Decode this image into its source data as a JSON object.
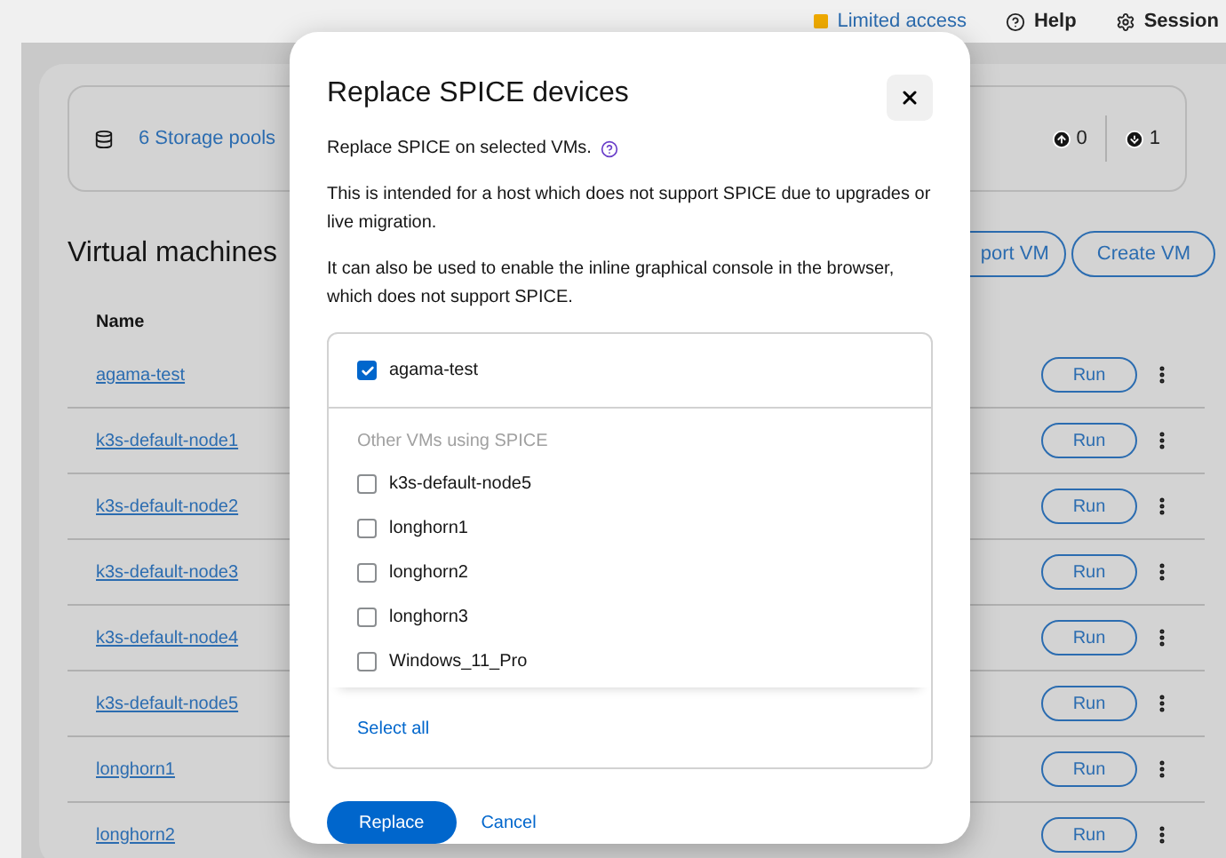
{
  "header": {
    "items": [
      {
        "kind": "warning",
        "label": "Limited access"
      },
      {
        "kind": "help",
        "label": "Help"
      },
      {
        "kind": "session",
        "label": "Session"
      }
    ]
  },
  "storage": {
    "label": "6 Storage pools",
    "counts": [
      {
        "kind": "up",
        "value": "0"
      },
      {
        "kind": "down",
        "value": "1"
      }
    ]
  },
  "vms": {
    "title": "Virtual machines",
    "actions": [
      "port VM",
      "Create VM"
    ],
    "name_column": "Name",
    "rows": [
      {
        "name": "agama-test",
        "action": "Run"
      },
      {
        "name": "k3s-default-node1",
        "action": "Run"
      },
      {
        "name": "k3s-default-node2",
        "action": "Run"
      },
      {
        "name": "k3s-default-node3",
        "action": "Run"
      },
      {
        "name": "k3s-default-node4",
        "action": "Run"
      },
      {
        "name": "k3s-default-node5",
        "action": "Run"
      },
      {
        "name": "longhorn1",
        "action": "Run"
      },
      {
        "name": "longhorn2",
        "action": "Run"
      }
    ]
  },
  "dialog": {
    "title": "Replace SPICE devices",
    "intro": "Replace SPICE on selected VMs.",
    "paragraphs": [
      "This is intended for a host which does not support SPICE due to upgrades or live migration.",
      "It can also be used to enable the inline graphical console in the browser, which does not support SPICE."
    ],
    "selected_vms": [
      {
        "label": "agama-test",
        "checked": true
      }
    ],
    "group_label": "Other VMs using SPICE",
    "other_vms": [
      {
        "label": "k3s-default-node5",
        "checked": false
      },
      {
        "label": "longhorn1",
        "checked": false
      },
      {
        "label": "longhorn2",
        "checked": false
      },
      {
        "label": "longhorn3",
        "checked": false
      },
      {
        "label": "Windows_11_Pro",
        "checked": false
      }
    ],
    "select_all": "Select all",
    "primary_button": "Replace",
    "cancel_button": "Cancel"
  }
}
